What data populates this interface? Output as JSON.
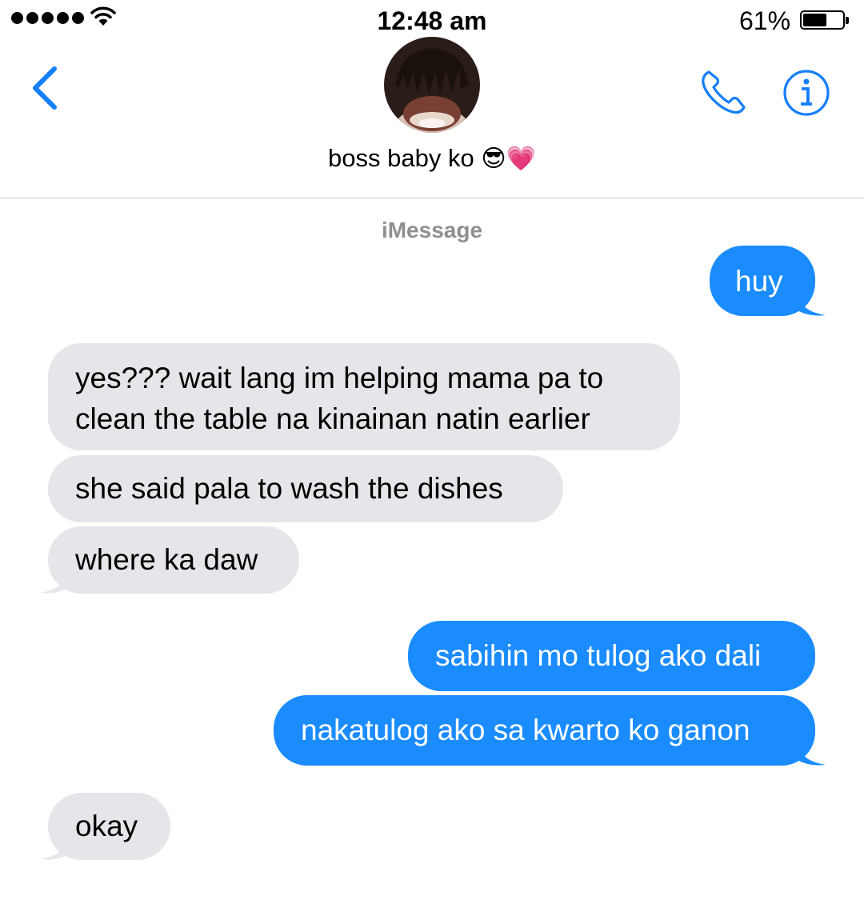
{
  "status_bar": {
    "time": "12:48 am",
    "battery_percent": "61%",
    "battery_level": 0.61,
    "signal_bars": 5,
    "icons": [
      "signal-dots-icon",
      "wifi-icon",
      "battery-icon"
    ]
  },
  "header": {
    "contact_name": "boss baby ko",
    "contact_emoji": "😎💗",
    "icons": [
      "back-chevron-icon",
      "avatar",
      "phone-icon",
      "info-icon"
    ]
  },
  "conversation": {
    "service_label": "iMessage",
    "messages": [
      {
        "side": "sent",
        "text": "huy"
      },
      {
        "side": "received",
        "text": "yes??? wait lang im helping mama pa to clean the table na kinainan natin earlier"
      },
      {
        "side": "received",
        "text": "she said pala to wash the dishes"
      },
      {
        "side": "received",
        "text": "where ka daw"
      },
      {
        "side": "sent",
        "text": "sabihin mo tulog ako dali"
      },
      {
        "side": "sent",
        "text": "nakatulog ako sa kwarto ko ganon"
      },
      {
        "side": "received",
        "text": "okay"
      }
    ]
  },
  "colors": {
    "accent": "#147efb",
    "sent_bubble": "#1a8cff",
    "received_bubble": "#e5e5ea",
    "secondary_text": "#8e8e93",
    "divider": "#c8c7cc"
  }
}
